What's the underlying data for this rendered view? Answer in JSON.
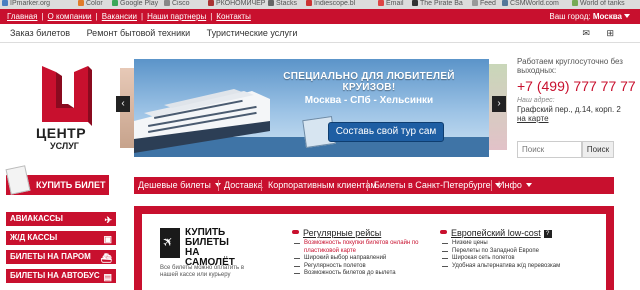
{
  "bookmarks": [
    "IPmarker.org",
    "Color",
    "Google Play",
    "Cisco",
    "РКОНОМИЧЕР",
    "Stacks",
    "Indiescope.bl",
    "Email",
    "The Pirate Ba",
    "Feed",
    "CSMWorld.com",
    "World of tanks"
  ],
  "topbar": {
    "links": [
      "Главная",
      "О компании",
      "Вакансии",
      "Наши партнеры",
      "Контакты"
    ],
    "city_label": "Ваш город:",
    "city_value": "Москва"
  },
  "subnav": [
    "Заказ билетов",
    "Ремонт бытовой техники",
    "Туристические услуги"
  ],
  "icons": {
    "mail": "mail-icon",
    "sitemap": "sitemap-icon"
  },
  "logo": {
    "line1": "ЦЕНТР",
    "line2": "УСЛУГ"
  },
  "banner": {
    "headline": "СПЕЦИАЛЬНО ДЛЯ ЛЮБИТЕЛЕЙ КРУИЗОВ!",
    "route": "Москва - СПб - Хельсинки",
    "cta": "Составь свой тур сам",
    "prev": "‹",
    "next": "›"
  },
  "contact": {
    "hours": "Работаем круглосуточно без выходных:",
    "phone": "+7 (499) 777 77 77",
    "address_label": "Наш адрес:",
    "address": "Графский пер., д.14, корп. 2",
    "map_link": "на карте"
  },
  "search": {
    "placeholder": "Поиск",
    "button": "Поиск"
  },
  "buy_ticket": "КУПИТЬ БИЛЕТ",
  "main_nav": [
    {
      "label": "Дешевые билеты",
      "dropdown": true
    },
    {
      "label": "Доставка",
      "dropdown": false
    },
    {
      "label": "Корпоративным клиентам",
      "dropdown": false
    },
    {
      "label": "Билеты в Санкт-Петербурге",
      "dropdown": true
    },
    {
      "label": "Инфо",
      "dropdown": true
    }
  ],
  "side_menu": [
    {
      "label": "АВИАКАССЫ",
      "icon": "plane-icon"
    },
    {
      "label": "Ж/Д КАССЫ",
      "icon": "train-icon"
    },
    {
      "label": "БИЛЕТЫ НА ПАРОМ",
      "icon": "ferry-icon"
    },
    {
      "label": "БИЛЕТЫ НА АВТОБУС",
      "icon": "bus-icon"
    }
  ],
  "panel": {
    "buy_plane": "КУПИТЬ БИЛЕТЫ НА САМОЛЁТ",
    "note": "Все билеты можно оплатить в нашей кассе или курьеру",
    "regular": {
      "title": "Регулярные рейсы",
      "items": [
        "Возможность покупки билетов онлайн по пластиковой карте",
        "Широкий выбор направлений",
        "Регулярность полетов",
        "Возможность билетов до вылета"
      ]
    },
    "lowcost": {
      "title": "Европейский low-cost",
      "qmark": "?",
      "items": [
        "Низкие цены",
        "Перелеты по Западной Европе",
        "Широкая сеть полетов",
        "Удобная альтернатива ж/д перевозкам"
      ]
    }
  },
  "colors": {
    "brand_red": "#c8102e",
    "phone_red": "#c8102e",
    "cta_blue": "#1e5ea3"
  }
}
